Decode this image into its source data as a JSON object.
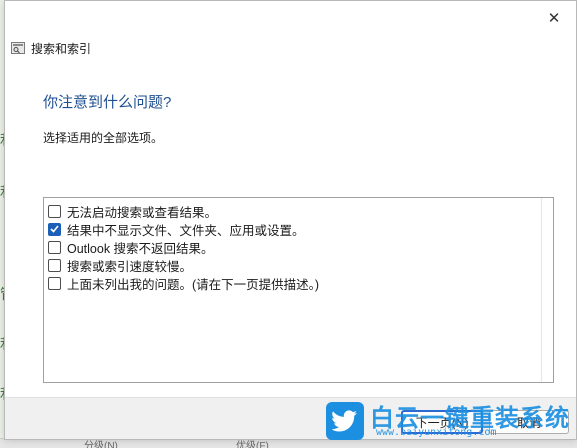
{
  "dialog": {
    "title": "搜索和索引",
    "close_glyph": "✕",
    "heading": "你注意到什么问题?",
    "instruction": "选择适用的全部选项。"
  },
  "options": [
    {
      "label": "无法启动搜索或查看结果。",
      "checked": false
    },
    {
      "label": "结果中不显示文件、文件夹、应用或设置。",
      "checked": true
    },
    {
      "label": "Outlook 搜索不返回结果。",
      "checked": false
    },
    {
      "label": "搜索或索引速度较慢。",
      "checked": false
    },
    {
      "label": "上面未列出我的问题。(请在下一页提供描述。)",
      "checked": false
    }
  ],
  "buttons": {
    "next": "下一页(N)",
    "cancel": "取消"
  },
  "watermark": {
    "title": "白云一键重装系统",
    "url": "www.baiyunxitong.com"
  },
  "background": {
    "left_glyphs": [
      "利",
      "利",
      "管",
      "利",
      "利"
    ],
    "bottom_text_1": "分级(N)",
    "bottom_text_2": "优级(F)"
  },
  "colors": {
    "accent": "#1c5fb7",
    "heading": "#1e4f91",
    "watermark": "#1d8fe1"
  },
  "icons": {
    "app": "search-indexing-icon",
    "close": "close-icon",
    "checkmark": "checkmark-icon",
    "watermark": "twitter-bird-icon"
  }
}
